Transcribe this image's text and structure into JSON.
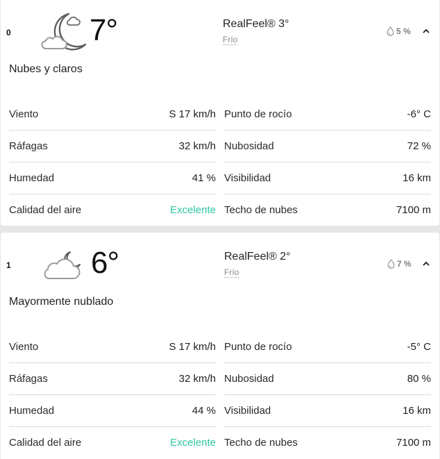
{
  "hours": [
    {
      "hour": "0",
      "icon": "moon-cloud-icon",
      "temp": "7°",
      "realfeel": "RealFeel® 3°",
      "realfeel_phrase": "Frío",
      "precip": "5 %",
      "phrase": "Nubes y claros",
      "details_left": [
        {
          "label": "Viento",
          "value": "S 17 km/h"
        },
        {
          "label": "Ráfagas",
          "value": "32 km/h"
        },
        {
          "label": "Humedad",
          "value": "41 %"
        },
        {
          "label": "Calidad del aire",
          "value": "Excelente"
        }
      ],
      "details_right": [
        {
          "label": "Punto de rocío",
          "value": "-6° C"
        },
        {
          "label": "Nubosidad",
          "value": "72 %"
        },
        {
          "label": "Visibilidad",
          "value": "16 km"
        },
        {
          "label": "Techo de nubes",
          "value": "7100 m"
        }
      ]
    },
    {
      "hour": "1",
      "icon": "cloud-moon-icon",
      "temp": "6°",
      "realfeel": "RealFeel® 2°",
      "realfeel_phrase": "Frío",
      "precip": "7 %",
      "phrase": "Mayormente nublado",
      "details_left": [
        {
          "label": "Viento",
          "value": "S 17 km/h"
        },
        {
          "label": "Ráfagas",
          "value": "32 km/h"
        },
        {
          "label": "Humedad",
          "value": "44 %"
        },
        {
          "label": "Calidad del aire",
          "value": "Excelente"
        }
      ],
      "details_right": [
        {
          "label": "Punto de rocío",
          "value": "-5° C"
        },
        {
          "label": "Nubosidad",
          "value": "80 %"
        },
        {
          "label": "Visibilidad",
          "value": "16 km"
        },
        {
          "label": "Techo de nubes",
          "value": "7100 m"
        }
      ]
    }
  ],
  "colors": {
    "air_quality_good": "#2ec6a2",
    "divider": "#dadada",
    "page_bg": "#e6e6e6"
  }
}
